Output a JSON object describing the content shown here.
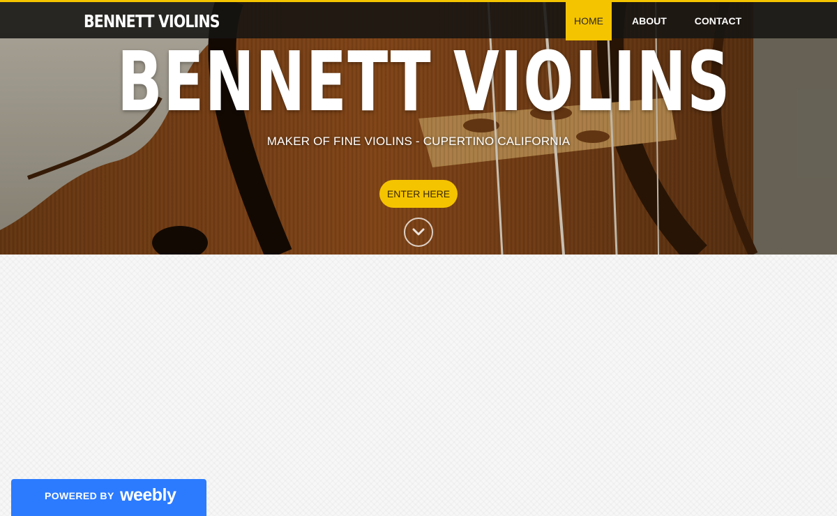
{
  "site": {
    "logo": "BENNETT VIOLINS"
  },
  "nav": {
    "items": [
      {
        "label": "HOME",
        "active": true
      },
      {
        "label": "ABOUT",
        "active": false
      },
      {
        "label": "CONTACT",
        "active": false
      }
    ]
  },
  "hero": {
    "title": "BENNETT VIOLINS",
    "subtitle": "MAKER OF FINE VIOLINS - CUPERTINO CALIFORNIA",
    "cta_label": "ENTER HERE",
    "scroll_icon": "chevron-down-icon"
  },
  "badge": {
    "powered_by": "POWERED BY",
    "brand": "weebly"
  },
  "colors": {
    "accent": "#f5c400",
    "badge_blue": "#2c7bff",
    "topbar": "#161412"
  }
}
